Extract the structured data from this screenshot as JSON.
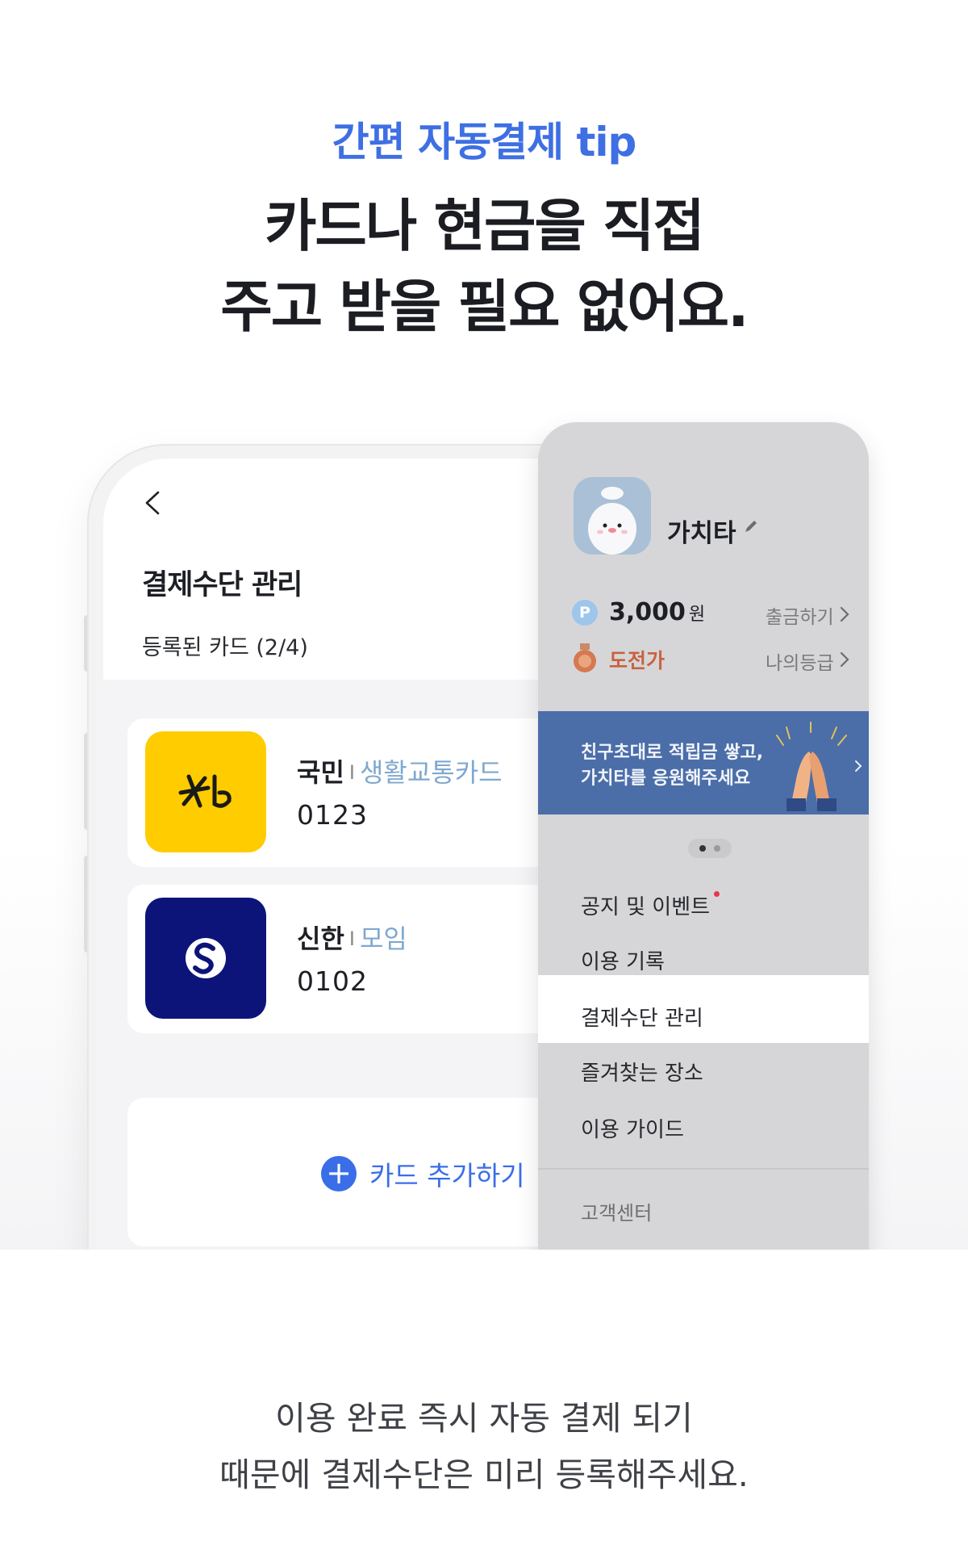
{
  "header": {
    "eyebrow": "간편 자동결제 tip",
    "headline_line1": "카드나 현금을 직접",
    "headline_line2": "주고 받을 필요 없어요."
  },
  "phone": {
    "title": "결제수단 관리",
    "registered_label": "등록된 카드 (2/4)",
    "cards": [
      {
        "issuer": "국민",
        "separator": "I",
        "type": "생활교통카드",
        "number": "0123",
        "logo_text": "★b",
        "logo_color": "#ffcc00"
      },
      {
        "issuer": "신한",
        "separator": "I",
        "type": "모임",
        "number": "0102",
        "logo_text": "S",
        "logo_color": "#0d1479"
      }
    ],
    "add_card_label": "카드 추가하기",
    "add_icon": "+"
  },
  "side_menu": {
    "nickname": "가치타",
    "points_icon": "P",
    "points_value": "3,000",
    "points_unit": "원",
    "withdraw_label": "출금하기",
    "grade_label": "도전가",
    "my_grade_label": "나의등급",
    "banner_line1": "친구초대로 적립금 쌓고,",
    "banner_line2": "가치타를 응원해주세요",
    "items": [
      "공지 및 이벤트",
      "이용 기록",
      "결제수단 관리",
      "즐겨찾는 장소",
      "이용 가이드"
    ],
    "active_item_index": 2,
    "footer_item": "고객센터"
  },
  "footer": {
    "line1": "이용 완료 즉시 자동 결제 되기",
    "line2": "때문에 결제수단은 미리 등록해주세요."
  },
  "colors": {
    "accent": "#3e6fe3",
    "kb_yellow": "#ffcc00",
    "shinhan_navy": "#0d1479",
    "banner_blue": "#4b6ea8",
    "grade_orange": "#c8623f"
  }
}
